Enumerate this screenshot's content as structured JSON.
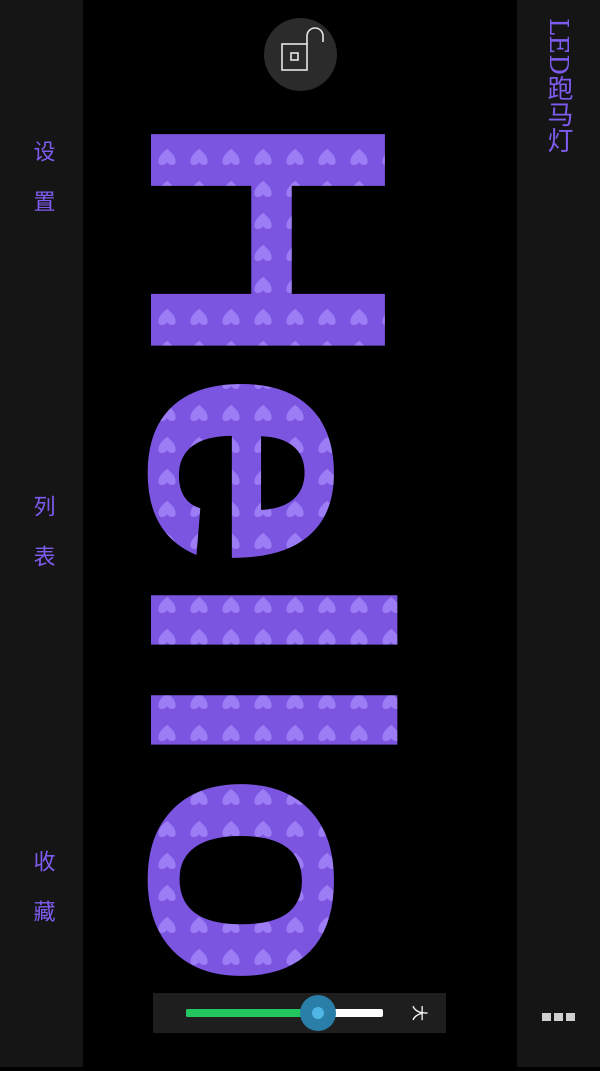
{
  "app": {
    "title": "LED跑马灯"
  },
  "sidebar": {
    "items": [
      {
        "label": "设置"
      },
      {
        "label": "列表"
      },
      {
        "label": "收藏"
      }
    ]
  },
  "marquee": {
    "text": "Hello",
    "fill_color": "#7b55e0",
    "pattern_color": "#9d7df5",
    "pattern": "heart",
    "background_color": "#000000"
  },
  "lock": {
    "icon": "unlock-icon"
  },
  "size_slider": {
    "value_fraction": 0.67,
    "label": "大"
  },
  "more": {
    "icon": "more-dots-icon"
  },
  "colors": {
    "accent": "#7f5cf0",
    "slider_fill": "#22c55e",
    "thumb": "#2a7fa8"
  }
}
